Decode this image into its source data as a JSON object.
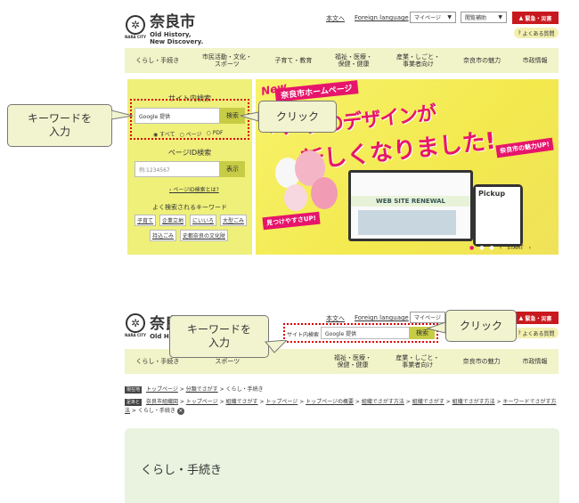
{
  "site": {
    "logo_name": "奈良市",
    "tagline1": "Old History,",
    "tagline2": "New Discovery.",
    "logo_sub": "NARA CITY"
  },
  "header": {
    "text_version": "本文へ",
    "foreign_language": "Foreign language",
    "mypage": "マイページ",
    "reading_support": "閲覧補助",
    "emergency": "緊急・災害",
    "faq": "よくある質問"
  },
  "nav": [
    "くらし・手続き",
    "市民活動・文化・スポーツ",
    "子育て・教育",
    "福祉・医療・保健・健康",
    "産業・しごと・事業者向け",
    "奈良市の魅力",
    "市政情報"
  ],
  "site_search": {
    "title": "サイト内検索",
    "engine": "Google 提供",
    "button": "検索",
    "options": [
      "すべて",
      "ページ",
      "PDF"
    ]
  },
  "page_id_search": {
    "title": "ページID検索",
    "placeholder": "例:1234567",
    "button": "表示",
    "help_link": "ページID検索とは?"
  },
  "keywords": {
    "title": "よく検索されるキーワード",
    "items": [
      "子育て",
      "企業立地",
      "にいいろ",
      "大型ごみ",
      "持込ごみ",
      "史都奈良の文化財"
    ]
  },
  "banner": {
    "new": "New",
    "line1": "奈良市ホームページ",
    "line2": "ページのデザインが",
    "line3": "新しくなりました!",
    "badge1": "見つけやすさUP!",
    "badge2": "奈良市の魅力UP!",
    "renewal": "WEB SITE RENEWAL",
    "pickup": "Pickup",
    "start": "START"
  },
  "callouts": {
    "keyword_input": "キーワードを\n入力",
    "click": "クリック"
  },
  "header2": {
    "search_label": "サイト内検索",
    "engine": "Google 提供",
    "button": "検索",
    "mypage": "マイページ"
  },
  "breadcrumbs": {
    "current_label": "現在地",
    "current": [
      "トップページ",
      "分類でさがす",
      "くらし・手続き"
    ],
    "path_label": "足あと",
    "path": [
      "奈良市組織図",
      "トップページ",
      "組織でさがす",
      "トップページ",
      "トップページの概要",
      "組織でさがす方法",
      "組織でさがす",
      "組織でさがす方法",
      "キーワードでさがす方法",
      "くらし・手続き"
    ]
  },
  "page": {
    "heading": "くらし・手続き"
  },
  "colors": {
    "panel": "#eef07a",
    "nav": "#f1f3c8",
    "accent_red": "#c8191e",
    "callout": "#f2f4cf",
    "content_bg": "#e9f3df"
  }
}
